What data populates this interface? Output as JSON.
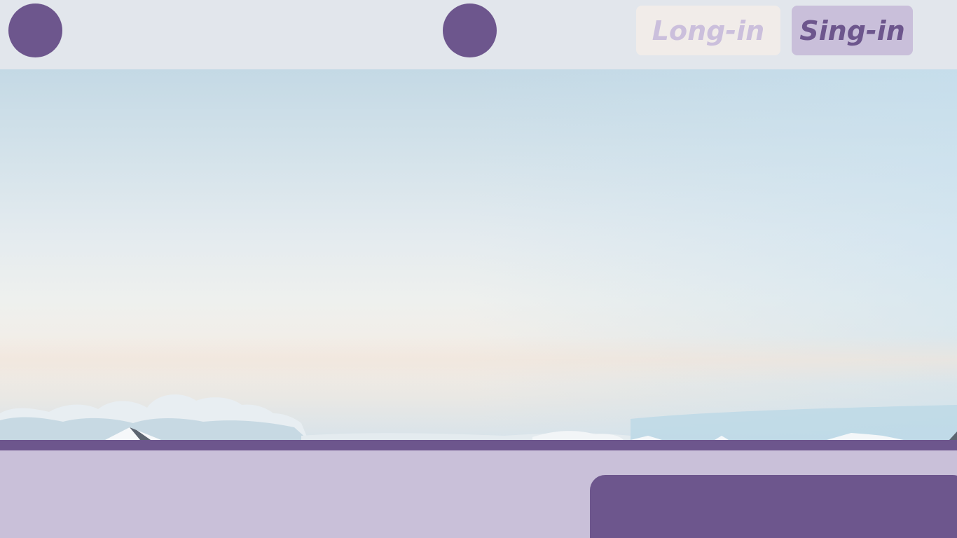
{
  "header": {
    "login_label": "Long-in",
    "signin_label": "Sing-in"
  },
  "icons": {
    "left_circle": "circle-icon",
    "center_circle": "circle-icon"
  },
  "colors": {
    "brand_purple": "#6d568d",
    "light_purple": "#c9c0d9",
    "header_bg": "#e2e6ec",
    "login_bg": "#f1ece9",
    "login_text": "#cbbfdc"
  }
}
